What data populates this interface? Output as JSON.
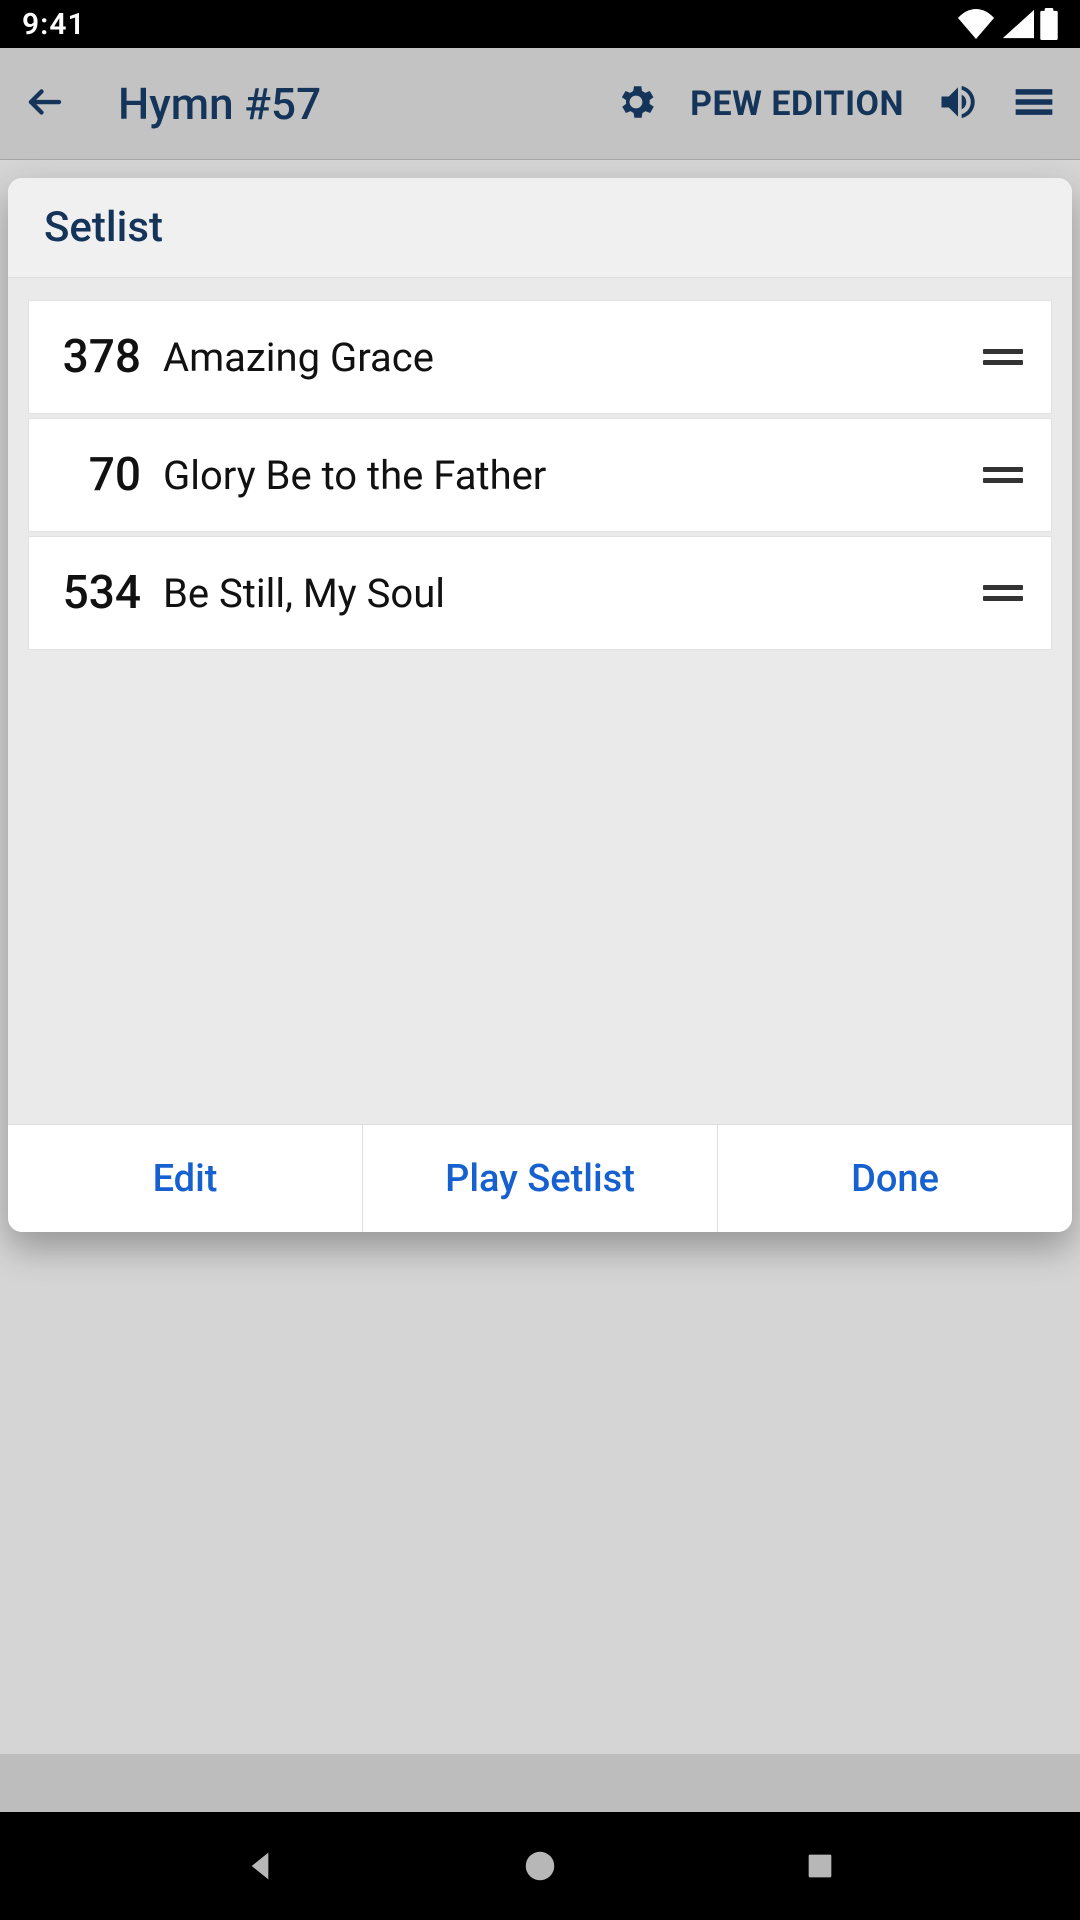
{
  "status": {
    "time": "9:41"
  },
  "appbar": {
    "title": "Hymn #57",
    "edition": "PEW EDITION"
  },
  "dialog": {
    "title": "Setlist",
    "items": [
      {
        "number": "378",
        "title": "Amazing Grace"
      },
      {
        "number": "70",
        "title": "Glory Be to the Father"
      },
      {
        "number": "534",
        "title": "Be Still, My Soul"
      }
    ],
    "actions": {
      "edit": "Edit",
      "play": "Play Setlist",
      "done": "Done"
    }
  },
  "colors": {
    "accent_dark": "#14345a",
    "link_blue": "#1660d0",
    "dialog_header_bg": "#f0f0f0"
  }
}
